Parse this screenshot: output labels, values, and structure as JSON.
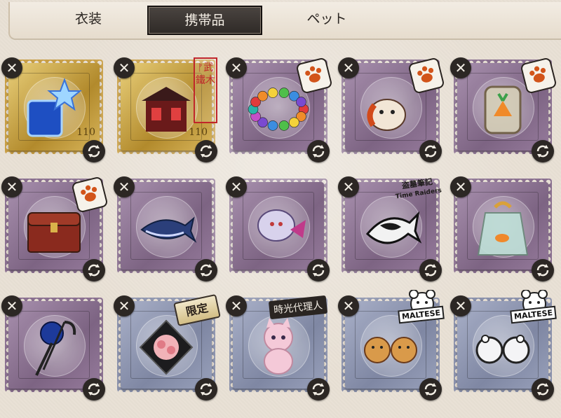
{
  "tabs": [
    {
      "label": "衣装",
      "active": false
    },
    {
      "label": "携帯品",
      "active": true
    },
    {
      "label": "ペット",
      "active": false
    }
  ],
  "colors": {
    "active_tab_bg": "#2f2a27",
    "background": "#e9e1d5",
    "gold_stamp": "#d0ad52",
    "purple_stamp": "#8f7595",
    "blue_stamp": "#8d94ae"
  },
  "items": [
    {
      "name": "blue-crystal-star",
      "frame": "gold",
      "badge": null,
      "price_text": "110"
    },
    {
      "name": "red-shrine-house",
      "frame": "gold",
      "badge": "stamp-red",
      "badge_text": "ᚠ武鐵木",
      "price_text": "110"
    },
    {
      "name": "rainbow-bead-bracelet",
      "frame": "purple",
      "badge": "paw"
    },
    {
      "name": "tiger-cat-charm",
      "frame": "purple",
      "badge": "paw"
    },
    {
      "name": "jar-with-carrot",
      "frame": "purple",
      "badge": "paw"
    },
    {
      "name": "red-treasure-chest",
      "frame": "purple",
      "badge": "paw"
    },
    {
      "name": "blue-whale",
      "frame": "purple",
      "badge": null
    },
    {
      "name": "pink-ghost-fish",
      "frame": "purple",
      "badge": null
    },
    {
      "name": "black-white-koi",
      "frame": "purple",
      "badge": "timeraiders",
      "badge_text": "盗墓筆記",
      "badge_sub": "Time Raiders"
    },
    {
      "name": "fish-in-bag",
      "frame": "purple",
      "badge": null
    },
    {
      "name": "blue-rose-umbrella",
      "frame": "purple",
      "badge": null
    },
    {
      "name": "rose-bouquet-box",
      "frame": "blue",
      "badge": "limit",
      "badge_text": "限定"
    },
    {
      "name": "pink-cat-plush",
      "frame": "blue",
      "badge": "tag",
      "badge_text": "時光代理人"
    },
    {
      "name": "bear-cookie-pair",
      "frame": "blue",
      "badge": "bear",
      "badge_text": "MALTESE"
    },
    {
      "name": "bear-glasses-pair",
      "frame": "blue",
      "badge": "bear",
      "badge_text": "MALTESE"
    }
  ]
}
